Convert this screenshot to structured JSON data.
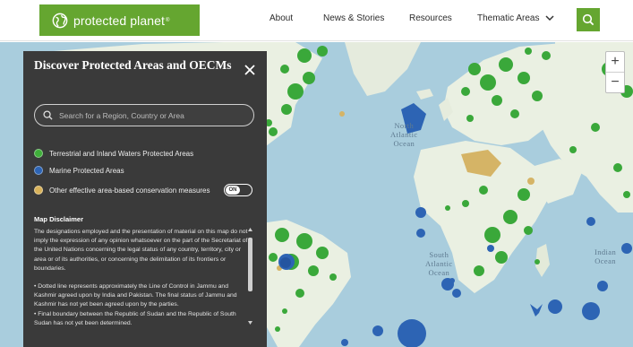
{
  "header": {
    "logo_text": "protected planet",
    "logo_registered": "®",
    "nav": [
      {
        "label": "About"
      },
      {
        "label": "News & Stories"
      },
      {
        "label": "Resources"
      },
      {
        "label": "Thematic Areas"
      }
    ]
  },
  "map": {
    "ocean_labels": {
      "north_atlantic": [
        "North",
        "Atlantic",
        "Ocean"
      ],
      "south_atlantic": [
        "South",
        "Atlantic",
        "Ocean"
      ],
      "indian": [
        "Indian",
        "Ocean"
      ]
    },
    "colors": {
      "ocean": "#a9cddd",
      "land": "#eaf0e2",
      "terrestrial": "#3aa83a",
      "marine": "#2d64b4",
      "oecm": "#d5b466"
    }
  },
  "panel": {
    "title": "Discover Protected Areas and OECMs",
    "search_placeholder": "Search for a Region, Country or Area",
    "legend": [
      {
        "label": "Terrestrial and Inland Waters Protected Areas",
        "color": "#3fae3a"
      },
      {
        "label": "Marine Protected Areas",
        "color": "#2d64b4"
      },
      {
        "label": "Other effective area-based conservation measures",
        "color": "#d8b25a"
      }
    ],
    "toggle_label": "ON",
    "disclaimer_title": "Map Disclaimer",
    "disclaimer_paragraph": "The designations employed and the presentation of material on this map do not imply the expression of any opinion whatsoever on the part of the Secretariat of the United Nations concerning the legal status of any country, territory, city or area or of its authorities, or concerning the delimitation of its frontiers or boundaries.",
    "disclaimer_bullets": [
      "• Dotted line represents approximately the Line of Control in Jammu and Kashmir agreed upon by India and Pakistan. The final status of Jammu and Kashmir has not yet been agreed upon by the parties.",
      "• Final boundary between the Republic of Sudan and the Republic of South Sudan has not yet been determined."
    ]
  },
  "zoom": {
    "in_label": "+",
    "out_label": "−"
  }
}
